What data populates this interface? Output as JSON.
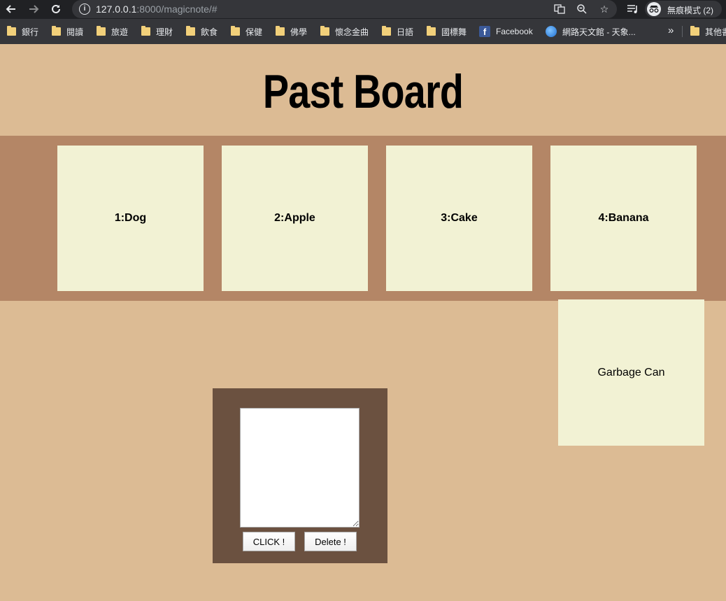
{
  "browser": {
    "url_host": "127.0.0.1",
    "url_rest": ":8000/magicnote/#",
    "incognito_label": "無痕模式 (2)",
    "bookmarks": [
      {
        "label": "銀行",
        "icon": "folder-icon"
      },
      {
        "label": "閱讀",
        "icon": "folder-icon"
      },
      {
        "label": "旅遊",
        "icon": "folder-icon"
      },
      {
        "label": "理財",
        "icon": "folder-icon"
      },
      {
        "label": "飲食",
        "icon": "folder-icon"
      },
      {
        "label": "保健",
        "icon": "folder-icon"
      },
      {
        "label": "佛學",
        "icon": "folder-icon"
      },
      {
        "label": "懷念金曲",
        "icon": "folder-icon"
      },
      {
        "label": "日語",
        "icon": "folder-icon"
      },
      {
        "label": "國標舞",
        "icon": "folder-icon"
      },
      {
        "label": "Facebook",
        "icon": "facebook-icon"
      },
      {
        "label": "網路天文館 - 天象...",
        "icon": "globe-icon"
      },
      {
        "label": "其他書",
        "icon": "folder-icon"
      }
    ],
    "more_glyph": "»"
  },
  "page": {
    "title": "Past Board",
    "notes": [
      {
        "label": "1:Dog"
      },
      {
        "label": "2:Apple"
      },
      {
        "label": "3:Cake"
      },
      {
        "label": "4:Banana"
      }
    ],
    "garbage_label": "Garbage Can",
    "editor": {
      "text_value": "",
      "click_label": "CLICK !",
      "delete_label": "Delete !"
    }
  },
  "colors": {
    "page_bg": "#dcbb94",
    "strip_bg": "#b48666",
    "note_bg": "#f2f2d4",
    "editor_bg": "#6b5140"
  }
}
